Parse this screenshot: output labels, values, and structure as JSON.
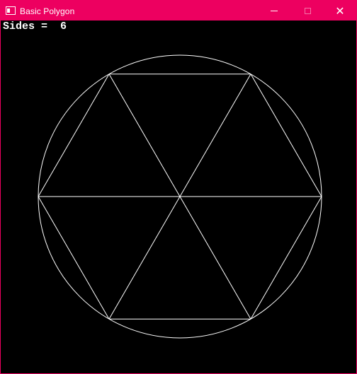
{
  "window": {
    "title": "Basic Polygon",
    "close_symbol": "✕",
    "icons": {
      "app": "app-window-icon",
      "minimize": "minimize-icon",
      "maximize": "maximize-icon",
      "close": "close-icon"
    },
    "colors": {
      "titlebar": "#ed0060",
      "background": "#000000",
      "stroke": "#ffffff",
      "text": "#ffffff"
    }
  },
  "canvas": {
    "sides_text": "Sides =  6",
    "sides": 6
  }
}
